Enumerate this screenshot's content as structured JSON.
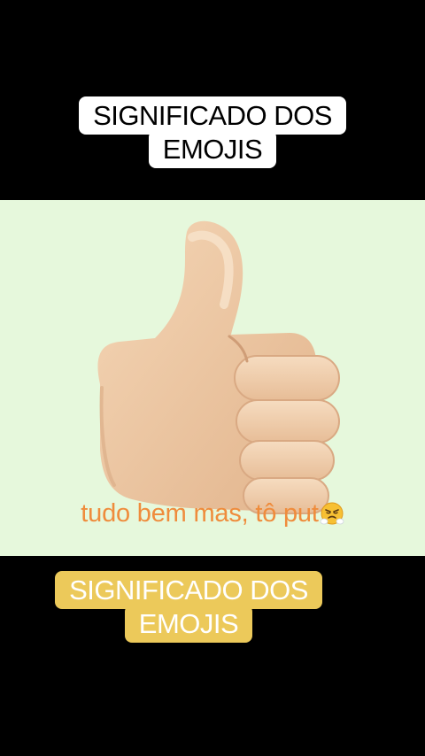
{
  "caption_top": {
    "line1": "SIGNIFICADO DOS",
    "line2": "EMOJIS"
  },
  "emoji": {
    "name": "thumbs-up-icon"
  },
  "subtitle": {
    "text": "tudo bem mas, tô put",
    "trailing_emoji": "face-with-steam-from-nose-icon"
  },
  "caption_bottom": {
    "line1": "SIGNIFICADO DOS",
    "line2": "EMOJIS"
  },
  "colors": {
    "background": "#000000",
    "panel": "#e6f8dc",
    "subtitle": "#ef8c3c",
    "caption_top_bg": "#ffffff",
    "caption_bottom_bg": "#ecc95a"
  }
}
